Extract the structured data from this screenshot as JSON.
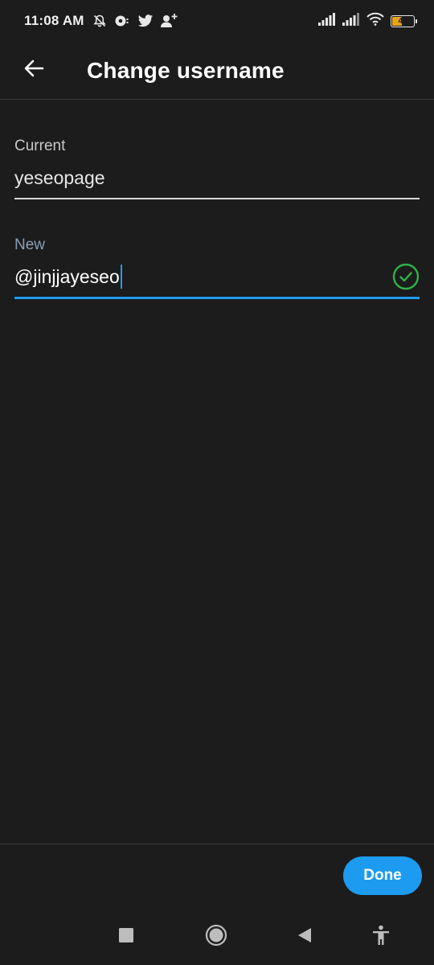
{
  "status_bar": {
    "time": "11:08 AM",
    "battery_level": "43",
    "battery_fraction": 0.43,
    "notification_icons": [
      "bell-muted-icon",
      "media-icon",
      "twitter-bird-icon",
      "add-person-icon"
    ],
    "system_icons": [
      "signal-icon",
      "signal-icon",
      "wifi-icon",
      "battery-icon"
    ]
  },
  "app_bar": {
    "title": "Change username",
    "back_icon": "arrow-left-icon"
  },
  "form": {
    "current": {
      "label": "Current",
      "value": "yeseopage"
    },
    "new": {
      "label": "New",
      "prefix": "@",
      "value": "jinjjayeseo",
      "valid_icon": "check-circle-icon"
    }
  },
  "actions": {
    "done_label": "Done"
  },
  "nav_bar": {
    "items": [
      "recents-square-icon",
      "home-circle-icon",
      "back-triangle-icon",
      "accessibility-icon"
    ]
  },
  "colors": {
    "background": "#1c1c1c",
    "accent": "#1d9bf0",
    "valid": "#2fb34a",
    "divider": "#3a3a3a"
  }
}
